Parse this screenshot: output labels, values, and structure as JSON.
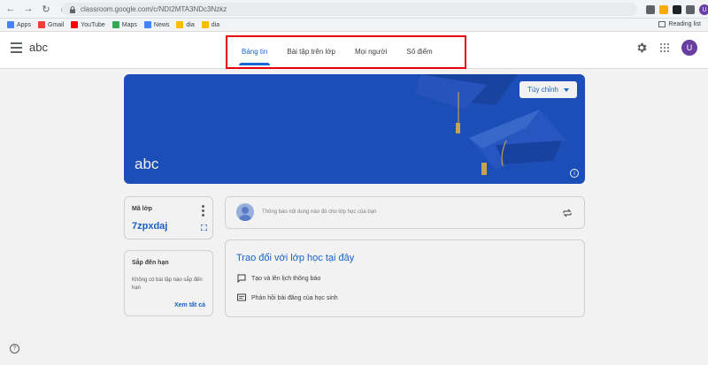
{
  "browser": {
    "url": "classroom.google.com/c/NDI2MTA3NDc3Nzkz",
    "profile_initial": "U",
    "bookmarks": [
      {
        "label": "Apps",
        "icon": "apps-grid-icon",
        "color": "#4285f4"
      },
      {
        "label": "Gmail",
        "icon": "gmail-icon",
        "color": "#ea4335"
      },
      {
        "label": "YouTube",
        "icon": "youtube-icon",
        "color": "#ff0000"
      },
      {
        "label": "Maps",
        "icon": "maps-icon",
        "color": "#34a853"
      },
      {
        "label": "News",
        "icon": "news-icon",
        "color": "#4285f4"
      },
      {
        "label": "dia",
        "icon": "bookmark-icon",
        "color": "#fbbc04"
      },
      {
        "label": "dia",
        "icon": "bookmark-icon",
        "color": "#fbbc04"
      }
    ],
    "reading_list": "Reading list"
  },
  "header": {
    "class_name": "abc",
    "tabs": [
      {
        "label": "Bảng tin",
        "active": true
      },
      {
        "label": "Bài tập trên lớp",
        "active": false
      },
      {
        "label": "Mọi người",
        "active": false
      },
      {
        "label": "Số điểm",
        "active": false
      }
    ],
    "avatar_initial": "U"
  },
  "banner": {
    "title": "abc",
    "customize_label": "Tùy chỉnh",
    "color": "#1e53c2"
  },
  "class_code": {
    "label": "Mã lớp",
    "value": "7zpxdaj"
  },
  "upcoming": {
    "title": "Sắp đến hạn",
    "description": "Không có bài tập nào sắp đến hạn",
    "view_all": "Xem tất cả"
  },
  "announce": {
    "placeholder": "Thông báo nội dung nào đó cho lớp học của bạn"
  },
  "communicate": {
    "title": "Trao đổi với lớp học tại đây",
    "items": [
      {
        "label": "Tạo và lên lịch thông báo",
        "icon": "announcement-icon"
      },
      {
        "label": "Phản hồi bài đăng của học sinh",
        "icon": "comment-icon"
      }
    ]
  },
  "colors": {
    "accent": "#1967d2",
    "highlight_border": "#e5000b"
  }
}
